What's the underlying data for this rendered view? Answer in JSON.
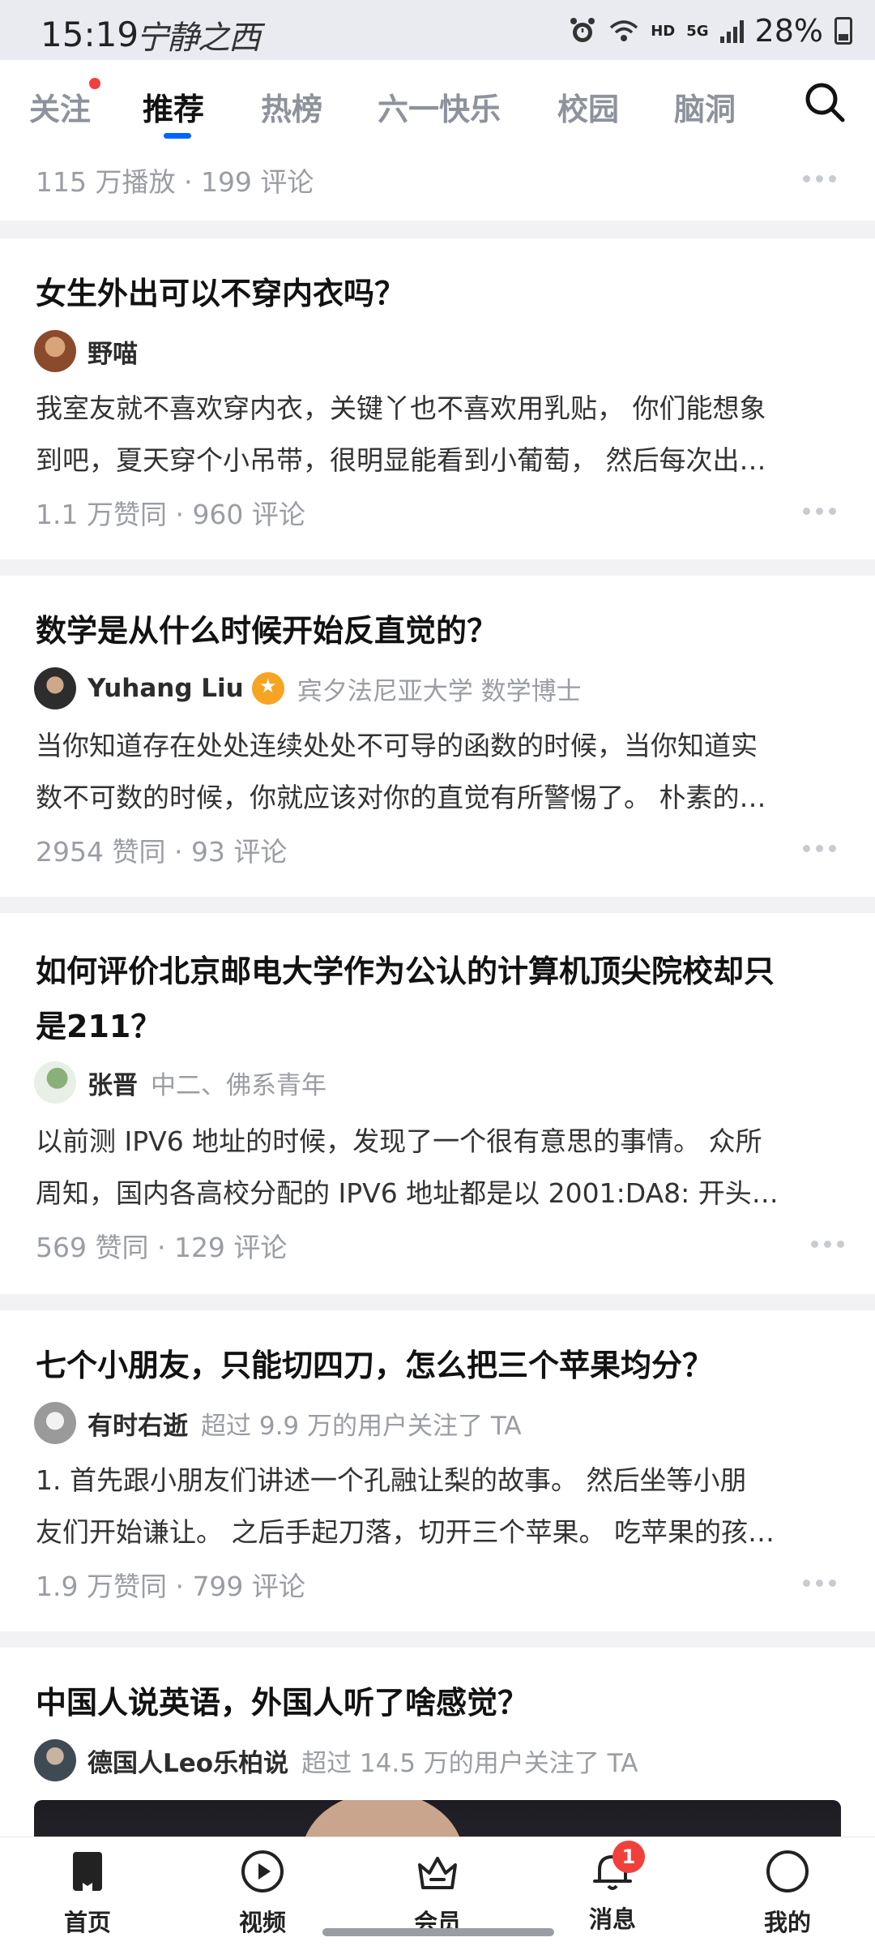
{
  "status_bar": {
    "time": "15:19",
    "handwriting": "宁静之西",
    "network_hd": "HD",
    "network_5g": "5G",
    "battery": "28%"
  },
  "top_nav": {
    "tabs": [
      "关注",
      "推荐",
      "热榜",
      "六一快乐",
      "校园",
      "脑洞"
    ],
    "active_tab": "推荐"
  },
  "feed": {
    "top_partial": {
      "meta": "115 万播放 · 199 评论"
    },
    "items": [
      {
        "title": "女生外出可以不穿内衣吗？",
        "author": "野喵",
        "author_desc": "",
        "excerpt_line1": "我室友就不喜欢穿内衣，关键丫也不喜欢用乳贴， 你们能想象",
        "excerpt_line2": "到吧，夏天穿个小吊带，很明显能看到小葡萄， 然后每次出…",
        "meta": "1.1 万赞同 · 960 评论"
      },
      {
        "title": "数学是从什么时候开始反直觉的？",
        "author": "Yuhang Liu",
        "author_desc": "宾夕法尼亚大学 数学博士",
        "excerpt_line1": "当你知道存在处处连续处处不可导的函数的时候，当你知道实",
        "excerpt_line2": "数不可数的时候，你就应该对你的直觉有所警惕了。 朴素的…",
        "meta": "2954 赞同 · 93 评论"
      },
      {
        "title_line1": "如何评价北京邮电大学作为公认的计算机顶尖院校却只",
        "title_line2": "是211？",
        "author": "张晋",
        "author_desc": "中二、佛系青年",
        "excerpt_line1": "以前测 IPV6 地址的时候，发现了一个很有意思的事情。 众所",
        "excerpt_line2": "周知，国内各高校分配的 IPV6 地址都是以 2001:DA8: 开头…",
        "meta": "569 赞同 · 129 评论"
      },
      {
        "title": "七个小朋友，只能切四刀，怎么把三个苹果均分？",
        "author": "有时右逝",
        "author_desc": "超过 9.9 万的用户关注了 TA",
        "excerpt_line1": "1. 首先跟小朋友们讲述一个孔融让梨的故事。 然后坐等小朋",
        "excerpt_line2": "友们开始谦让。 之后手起刀落，切开三个苹果。 吃苹果的孩…",
        "meta": "1.9 万赞同 · 799 评论"
      },
      {
        "title": "中国人说英语，外国人听了啥感觉？",
        "author": "德国人Leo乐柏说",
        "author_desc": "超过 14.5 万的用户关注了 TA"
      }
    ]
  },
  "bottom_nav": {
    "items": [
      "首页",
      "视频",
      "会员",
      "消息",
      "我的"
    ],
    "message_badge": "1"
  },
  "colors": {
    "accent": "#0066ff",
    "badge_red": "#f1403c",
    "muted": "#9a9da3"
  }
}
